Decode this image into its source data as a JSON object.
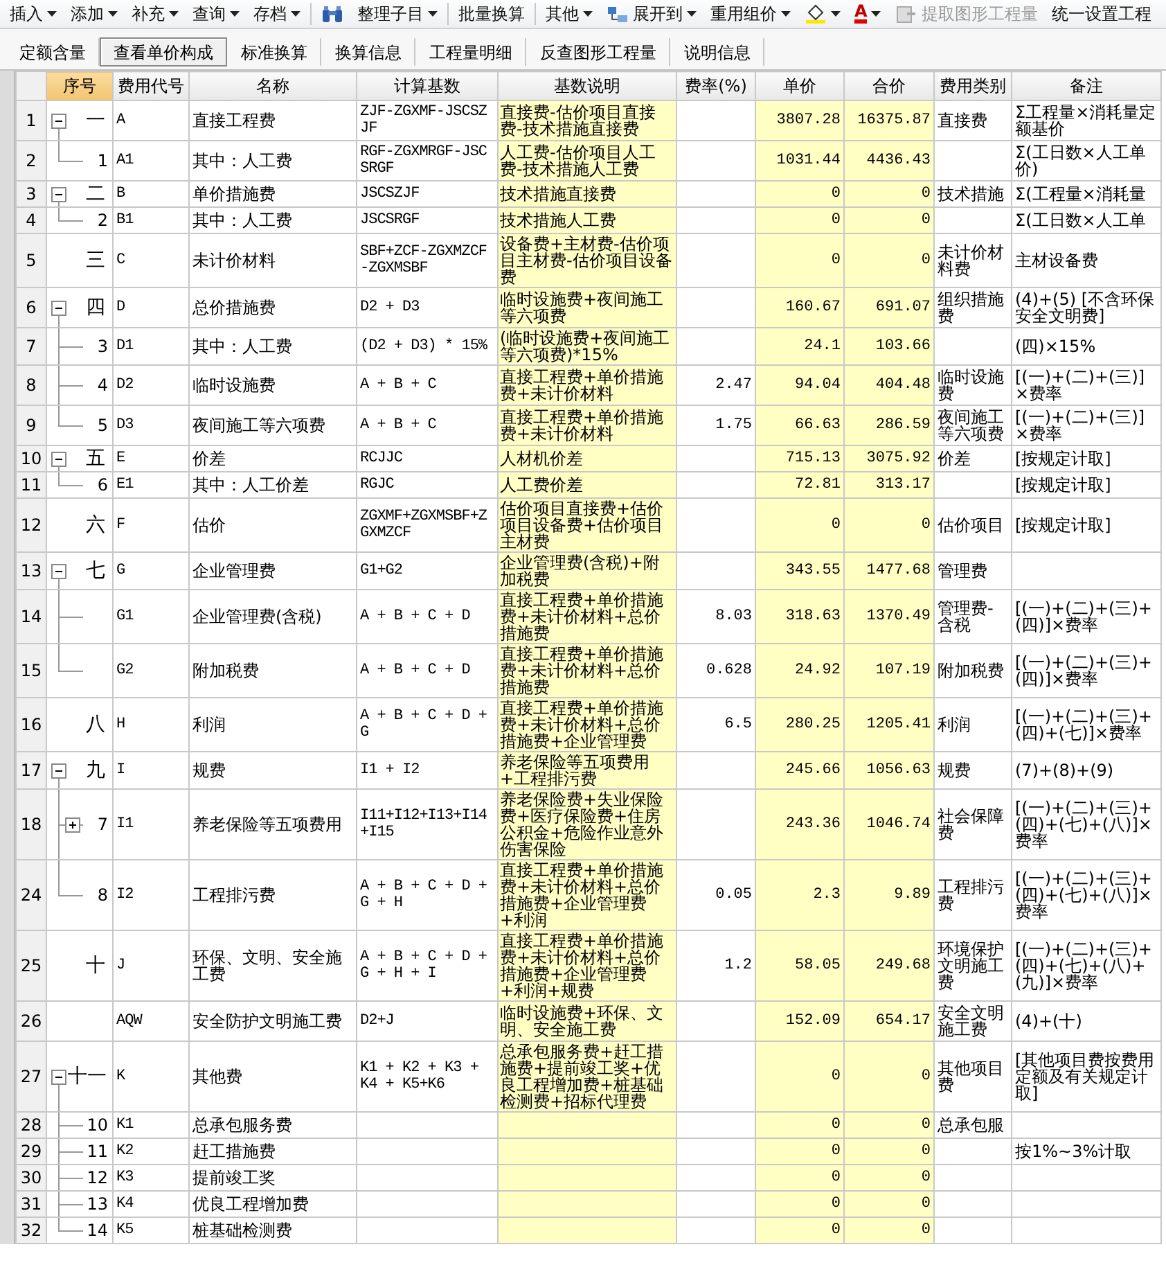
{
  "toolbar": [
    {
      "kind": "menu",
      "label": "插入",
      "dropdown": true,
      "disabled": false
    },
    {
      "kind": "menu",
      "label": "添加",
      "dropdown": true,
      "disabled": false
    },
    {
      "kind": "menu",
      "label": "补充",
      "dropdown": true,
      "disabled": false
    },
    {
      "kind": "menu",
      "label": "查询",
      "dropdown": true,
      "disabled": false
    },
    {
      "kind": "menu",
      "label": "存档",
      "dropdown": true,
      "disabled": false
    },
    {
      "kind": "search",
      "dropdown": false,
      "disabled": false,
      "separator": true
    },
    {
      "kind": "menu",
      "label": "整理子目",
      "dropdown": true,
      "disabled": false
    },
    {
      "kind": "menu",
      "label": "批量换算",
      "dropdown": false,
      "disabled": false,
      "separator": true
    },
    {
      "kind": "menu",
      "label": "其他",
      "dropdown": true,
      "disabled": false,
      "separator": true
    },
    {
      "kind": "expand",
      "label": "展开到",
      "dropdown": true,
      "disabled": false
    },
    {
      "kind": "menu",
      "label": "重用组价",
      "dropdown": true,
      "disabled": false
    },
    {
      "kind": "fill",
      "dropdown": true,
      "disabled": false
    },
    {
      "kind": "font",
      "label": "A",
      "dropdown": true,
      "disabled": false
    },
    {
      "kind": "extract",
      "label": "提取图形工程量",
      "dropdown": false,
      "disabled": true
    },
    {
      "kind": "menu",
      "label": "统一设置工程",
      "dropdown": false,
      "disabled": false
    }
  ],
  "tabs": [
    {
      "label": "定额含量",
      "selected": false
    },
    {
      "label": "查看单价构成",
      "selected": true
    },
    {
      "label": "标准换算",
      "selected": false
    },
    {
      "label": "换算信息",
      "selected": false
    },
    {
      "label": "工程量明细",
      "selected": false
    },
    {
      "label": "反查图形工程量",
      "selected": false
    },
    {
      "label": "说明信息",
      "selected": false
    }
  ],
  "table": {
    "columns": [
      "序号",
      "费用代号",
      "名称",
      "计算基数",
      "基数说明",
      "费率(%)",
      "单价",
      "合价",
      "费用类别",
      "备注"
    ],
    "rows": [
      {
        "row": "1",
        "seq": "一",
        "code": "A",
        "name": "直接工程费",
        "base": "ZJF-ZGXMF-JSCSZJF",
        "desc": "直接费-估价项目直接费-技术措施直接费",
        "unit": "3807.28",
        "total": "16375.87",
        "category": "直接费",
        "note": "Σ工程量×消耗量定额基价",
        "expanded": true,
        "children": [
          {
            "row": "2",
            "seq": "1",
            "code": "A1",
            "name": "其中：人工费",
            "base": "RGF-ZGXMRGF-JSCSRGF",
            "desc": "人工费-估价项目人工费-技术措施人工费",
            "unit": "1031.44",
            "total": "4436.43",
            "note": "Σ(工日数×人工单价)"
          }
        ]
      },
      {
        "row": "3",
        "seq": "二",
        "code": "B",
        "name": "单价措施费",
        "base": "JSCSZJF",
        "desc": "技术措施直接费",
        "unit": "0",
        "total": "0",
        "category": "技术措施",
        "note": "Σ(工程量×消耗量",
        "expanded": true,
        "children": [
          {
            "row": "4",
            "seq": "2",
            "code": "B1",
            "name": "其中：人工费",
            "base": "JSCSRGF",
            "desc": "技术措施人工费",
            "unit": "0",
            "total": "0",
            "note": "Σ(工日数×人工单"
          }
        ]
      },
      {
        "row": "5",
        "seq": "三",
        "code": "C",
        "name": "未计价材料",
        "base": "SBF+ZCF-ZGXMZCF-ZGXMSBF",
        "desc": "设备费+主材费-估价项目主材费-估价项目设备费",
        "unit": "0",
        "total": "0",
        "category": "未计价材料费",
        "note": "主材设备费"
      },
      {
        "row": "6",
        "seq": "四",
        "code": "D",
        "name": "总价措施费",
        "base": "D2 + D3",
        "desc": "临时设施费+夜间施工等六项费",
        "unit": "160.67",
        "total": "691.07",
        "category": "组织措施费",
        "note": "(4)+(5) [不含环保安全文明费]",
        "expanded": true,
        "children": [
          {
            "row": "7",
            "seq": "3",
            "code": "D1",
            "name": "其中：人工费",
            "base": "(D2 + D3) * 15%",
            "desc": "(临时设施费+夜间施工等六项费)*15%",
            "unit": "24.1",
            "total": "103.66",
            "note": "(四)×15%"
          },
          {
            "row": "8",
            "seq": "4",
            "code": "D2",
            "name": "临时设施费",
            "base": "A + B + C",
            "desc": "直接工程费+单价措施费+未计价材料",
            "rate": "2.47",
            "unit": "94.04",
            "total": "404.48",
            "category": "临时设施费",
            "note": "[(一)+(二)+(三)]×费率"
          },
          {
            "row": "9",
            "seq": "5",
            "code": "D3",
            "name": "夜间施工等六项费",
            "base": "A + B + C",
            "desc": "直接工程费+单价措施费+未计价材料",
            "rate": "1.75",
            "unit": "66.63",
            "total": "286.59",
            "category": "夜间施工等六项费",
            "note": "[(一)+(二)+(三)]×费率"
          }
        ]
      },
      {
        "row": "10",
        "seq": "五",
        "code": "E",
        "name": "价差",
        "base": "RCJJC",
        "desc": "人材机价差",
        "unit": "715.13",
        "total": "3075.92",
        "category": "价差",
        "note": "[按规定计取]",
        "expanded": true,
        "children": [
          {
            "row": "11",
            "seq": "6",
            "code": "E1",
            "name": "其中：人工价差",
            "base": "RGJC",
            "desc": "人工费价差",
            "unit": "72.81",
            "total": "313.17",
            "note": "[按规定计取]"
          }
        ]
      },
      {
        "row": "12",
        "seq": "六",
        "code": "F",
        "name": "估价",
        "base": "ZGXMF+ZGXMSBF+ZGXMZCF",
        "desc": "估价项目直接费+估价项目设备费+估价项目主材费",
        "unit": "0",
        "total": "0",
        "category": "估价项目",
        "note": "[按规定计取]"
      },
      {
        "row": "13",
        "seq": "七",
        "code": "G",
        "name": "企业管理费",
        "base": "G1+G2",
        "desc": "企业管理费(含税)+附加税费",
        "unit": "343.55",
        "total": "1477.68",
        "category": "管理费",
        "expanded": true,
        "children": [
          {
            "row": "14",
            "code": "G1",
            "name": "企业管理费(含税)",
            "base": "A + B + C + D",
            "desc": "直接工程费+单价措施费+未计价材料+总价措施费",
            "rate": "8.03",
            "unit": "318.63",
            "total": "1370.49",
            "category": "管理费-含税",
            "note": "[(一)+(二)+(三)+(四)]×费率"
          },
          {
            "row": "15",
            "code": "G2",
            "name": "附加税费",
            "base": "A + B + C + D",
            "desc": "直接工程费+单价措施费+未计价材料+总价措施费",
            "rate": "0.628",
            "unit": "24.92",
            "total": "107.19",
            "category": "附加税费",
            "note": "[(一)+(二)+(三)+(四)]×费率"
          }
        ]
      },
      {
        "row": "16",
        "seq": "八",
        "code": "H",
        "name": "利润",
        "base": "A + B + C + D + G",
        "desc": "直接工程费+单价措施费+未计价材料+总价措施费+企业管理费",
        "rate": "6.5",
        "unit": "280.25",
        "total": "1205.41",
        "category": "利润",
        "note": "[(一)+(二)+(三)+(四)+(七)]×费率"
      },
      {
        "row": "17",
        "seq": "九",
        "code": "I",
        "name": "规费",
        "base": "I1 + I2",
        "desc": "养老保险等五项费用+工程排污费",
        "unit": "245.66",
        "total": "1056.63",
        "category": "规费",
        "note": "(7)+(8)+(9)",
        "expanded": true,
        "children": [
          {
            "row": "18",
            "seq": "7",
            "code": "I1",
            "name": "养老保险等五项费用",
            "base": "I11+I12+I13+I14+I15",
            "desc": "养老保险费+失业保险费+医疗保险费+住房公积金+危险作业意外伤害保险",
            "unit": "243.36",
            "total": "1046.74",
            "category": "社会保障费",
            "note": "[(一)+(二)+(三)+(四)+(七)+(八)]×费率",
            "expanded": false
          },
          {
            "row": "24",
            "seq": "8",
            "code": "I2",
            "name": "工程排污费",
            "base": "A + B + C + D + G + H",
            "desc": "直接工程费+单价措施费+未计价材料+总价措施费+企业管理费+利润",
            "rate": "0.05",
            "unit": "2.3",
            "total": "9.89",
            "category": "工程排污费",
            "note": "[(一)+(二)+(三)+(四)+(七)+(八)]×费率"
          }
        ]
      },
      {
        "row": "25",
        "seq": "十",
        "code": "J",
        "name": "环保、文明、安全施工费",
        "base": "A + B + C + D + G + H + I",
        "desc": "直接工程费+单价措施费+未计价材料+总价措施费+企业管理费+利润+规费",
        "rate": "1.2",
        "unit": "58.05",
        "total": "249.68",
        "category": "环境保护文明施工费",
        "note": "[(一)+(二)+(三)+(四)+(七)+(八)+(九)]×费率"
      },
      {
        "row": "26",
        "code": "AQW",
        "name": "安全防护文明施工费",
        "base": "D2+J",
        "desc": "临时设施费+环保、文明、安全施工费",
        "unit": "152.09",
        "total": "654.17",
        "category": "安全文明施工费",
        "note": "(4)+(十)"
      },
      {
        "row": "27",
        "seq": "十一",
        "code": "K",
        "name": "其他费",
        "base": "K1 + K2 + K3 + K4 + K5+K6",
        "desc": "总承包服务费+赶工措施费+提前竣工奖+优良工程增加费+桩基础检测费+招标代理费",
        "unit": "0",
        "total": "0",
        "category": "其他项目费",
        "note": "[其他项目费按费用定额及有关规定计取]",
        "expanded": true,
        "children": [
          {
            "row": "28",
            "seq": "10",
            "code": "K1",
            "name": "总承包服务费",
            "unit": "0",
            "total": "0",
            "category": "总承包服"
          },
          {
            "row": "29",
            "seq": "11",
            "code": "K2",
            "name": "赶工措施费",
            "unit": "0",
            "total": "0",
            "note": "按1%~3%计取"
          },
          {
            "row": "30",
            "seq": "12",
            "code": "K3",
            "name": "提前竣工奖",
            "unit": "0",
            "total": "0"
          },
          {
            "row": "31",
            "seq": "13",
            "code": "K4",
            "name": "优良工程增加费",
            "unit": "0",
            "total": "0"
          },
          {
            "row": "32",
            "seq": "14",
            "code": "K5",
            "name": "桩基础检测费",
            "unit": "0",
            "total": "0"
          }
        ]
      }
    ]
  }
}
